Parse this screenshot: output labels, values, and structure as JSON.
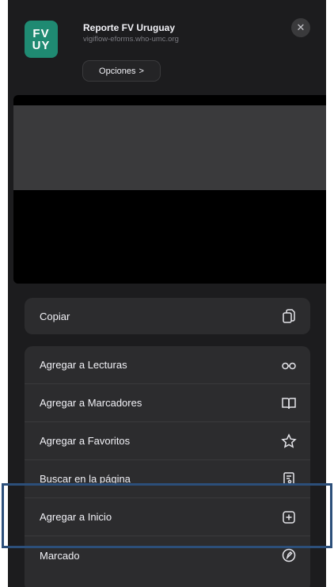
{
  "header": {
    "app_icon_line1": "FV",
    "app_icon_line2": "UY",
    "title": "Reporte FV Uruguay",
    "url": "vigiflow-eforms.who-umc.org",
    "options_label": "Opciones",
    "options_chevron": ">",
    "close_glyph": "✕"
  },
  "actions": {
    "copy": {
      "label": "Copiar",
      "icon": "copy-icon"
    },
    "items": [
      {
        "label": "Agregar a Lecturas",
        "icon": "glasses-icon"
      },
      {
        "label": "Agregar a Marcadores",
        "icon": "book-icon"
      },
      {
        "label": "Agregar a Favoritos",
        "icon": "star-icon"
      },
      {
        "label": "Buscar en la página",
        "icon": "find-icon"
      },
      {
        "label": "Agregar a Inicio",
        "icon": "add-square-icon"
      },
      {
        "label": "Marcado",
        "icon": "markup-icon"
      }
    ]
  },
  "highlight": {
    "color": "#2c4f7a",
    "target": "Agregar a Inicio"
  }
}
